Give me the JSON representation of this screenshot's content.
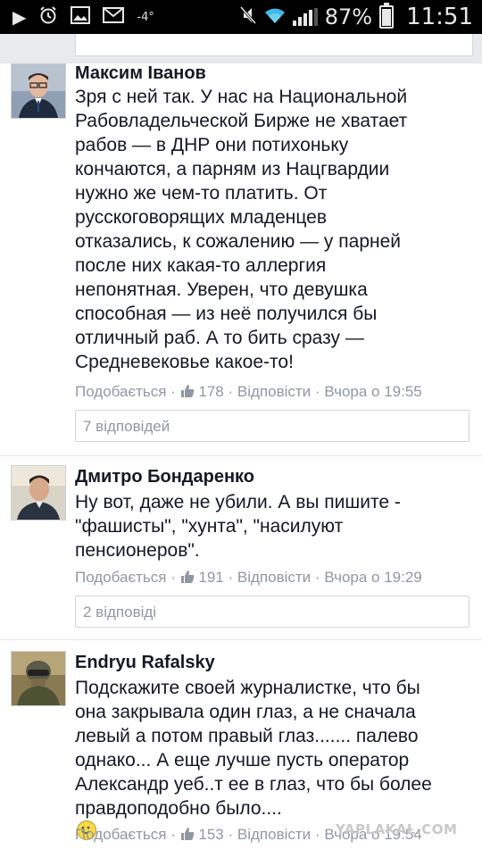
{
  "status_bar": {
    "battery_percent": "87%",
    "time": "11:51",
    "temp": "-4°",
    "icons": [
      "play-icon",
      "alarm-icon",
      "gallery-icon",
      "mail-icon",
      "mute-icon",
      "wifi-icon",
      "signal-icon",
      "battery-icon"
    ]
  },
  "comments": [
    {
      "author": "Максим Іванов",
      "lines": [
        "Зря с ней так. У нас на Национальной",
        "Рабовладельческой Бирже не хватает",
        "рабов — в ДНР они потихоньку",
        "кончаются, а парням из Нацгвардии",
        "нужно же чем-то платить. От",
        "русскоговорящих младенцев",
        "отказались, к сожалению — у парней",
        "после них какая-то аллергия",
        "непонятная. Уверен, что девушка",
        "способная — из неё получился бы",
        "отличный раб. А то бить сразу —",
        "Средневековье какое-то!"
      ],
      "like_label": "Подобається",
      "like_count": "178",
      "reply_label": "Відповісти",
      "time": "Вчора о 19:55",
      "replies_label": "7 відповідей"
    },
    {
      "author": "Дмитро Бондаренко",
      "lines": [
        "Ну вот, даже не убили. А вы пишите -",
        "\"фашисты\", \"хунта\", \"насилуют",
        "пенсионеров\"."
      ],
      "like_label": "Подобається",
      "like_count": "191",
      "reply_label": "Відповісти",
      "time": "Вчора о 19:29",
      "replies_label": "2 відповіді"
    },
    {
      "author": "Endryu Rafalsky",
      "lines": [
        "Подскажите своей журналистке, что бы",
        "она закрывала один глаз, а не сначала",
        "левый а потом правый глаз....... палево",
        "однако... А еще лучше пусть оператор",
        "Александр уеб..т ее в глаз, что бы более",
        "правдоподобно было...."
      ],
      "like_label": "Подобається",
      "like_count": "153",
      "reply_label": "Відповісти",
      "time": "Вчора о 19:54"
    }
  ],
  "watermark": "YAPLAKAL.COM",
  "sep": "·"
}
